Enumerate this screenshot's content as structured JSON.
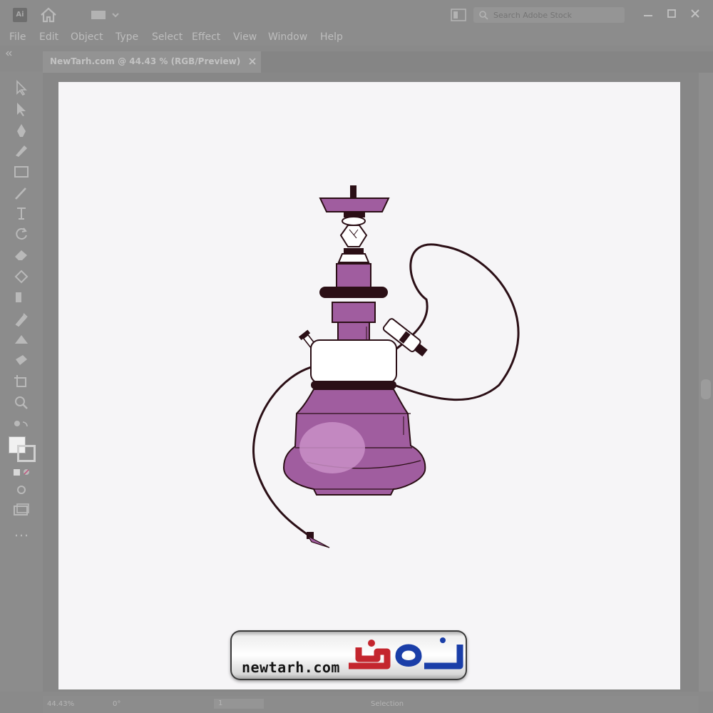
{
  "app": {
    "logo": "Ai"
  },
  "search": {
    "placeholder": "Search Adobe Stock"
  },
  "menu": {
    "items": [
      {
        "label": "File"
      },
      {
        "label": "Edit"
      },
      {
        "label": "Object"
      },
      {
        "label": "Type"
      },
      {
        "label": "Select"
      },
      {
        "label": "Effect"
      },
      {
        "label": "View"
      },
      {
        "label": "Window"
      },
      {
        "label": "Help"
      }
    ]
  },
  "document": {
    "tab_title": "NewTarh.com @ 44.43 % (RGB/Preview)"
  },
  "status": {
    "zoom": "44.43%",
    "angle": "0°",
    "artboard": "1",
    "mode": "Selection"
  },
  "watermark": {
    "logo_text": "نیوطرح",
    "url": "newtarh.com"
  },
  "colors": {
    "hookah_purple": "#a05d9f",
    "hookah_dark": "#2b0f16",
    "highlight": "#c98fc7",
    "artboard": "#f6f5f7",
    "ui_gray": "#8c8c8c"
  },
  "icons": [
    "home-icon",
    "selection-tool-icon",
    "direct-selection-icon",
    "pen-tool-icon",
    "pencil-tool-icon",
    "rectangle-tool-icon",
    "brush-tool-icon",
    "type-tool-icon",
    "rotate-tool-icon",
    "eraser-tool-icon",
    "scale-tool-icon",
    "gradient-tool-icon",
    "eyedropper-tool-icon",
    "blend-tool-icon",
    "symbol-tool-icon",
    "artboard-tool-icon",
    "zoom-tool-icon",
    "search-icon",
    "close-icon"
  ]
}
